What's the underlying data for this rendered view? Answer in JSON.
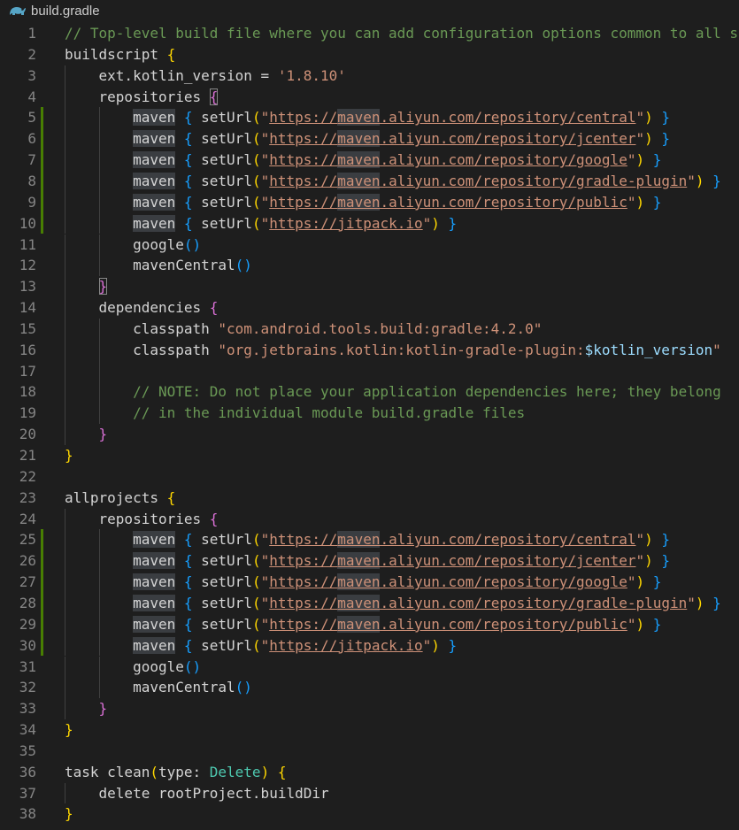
{
  "tab": {
    "title": "build.gradle",
    "icon": "gradle-elephant-icon",
    "icon_color": "#56a5c6"
  },
  "colors": {
    "background": "#1e1e1e",
    "line_number": "#858585",
    "added_line_marker": "#487e02",
    "comment": "#6a9955",
    "string": "#ce9178",
    "variable": "#9cdcfe",
    "type": "#4ec9b0",
    "bracket_level_1": "#ffd700",
    "bracket_level_2": "#da70d6",
    "bracket_level_3": "#179fff"
  },
  "lines": [
    {
      "num": "1",
      "modified": false,
      "guides": 0,
      "tokens": [
        {
          "t": "// Top-level build file where you can add configuration options common to all sub-projects/modules.",
          "c": "comment"
        }
      ]
    },
    {
      "num": "2",
      "modified": false,
      "guides": 0,
      "tokens": [
        {
          "t": "buildscript "
        },
        {
          "t": "{",
          "c": "b1"
        }
      ]
    },
    {
      "num": "3",
      "modified": false,
      "guides": 1,
      "tokens": [
        {
          "t": "    ext.kotlin_version = "
        },
        {
          "t": "'1.8.10'",
          "c": "str"
        }
      ]
    },
    {
      "num": "4",
      "modified": false,
      "guides": 1,
      "tokens": [
        {
          "t": "    repositories "
        },
        {
          "t": "{",
          "c": "b2",
          "m": "bm"
        }
      ]
    },
    {
      "num": "5",
      "modified": true,
      "guides": 2,
      "tokens": [
        {
          "t": "        "
        },
        {
          "t": "maven",
          "c": "hl"
        },
        {
          "t": " "
        },
        {
          "t": "{",
          "c": "b3"
        },
        {
          "t": " setUrl"
        },
        {
          "t": "(",
          "c": "b1"
        },
        {
          "t": "\"",
          "c": "str"
        },
        {
          "t": "https://",
          "c": "url"
        },
        {
          "t": "maven",
          "c": "url",
          "m": "hl"
        },
        {
          "t": ".aliyun.com/repository/central",
          "c": "url"
        },
        {
          "t": "\"",
          "c": "str"
        },
        {
          "t": ")",
          "c": "b1"
        },
        {
          "t": " "
        },
        {
          "t": "}",
          "c": "b3"
        }
      ]
    },
    {
      "num": "6",
      "modified": true,
      "guides": 2,
      "tokens": [
        {
          "t": "        "
        },
        {
          "t": "maven",
          "c": "hl"
        },
        {
          "t": " "
        },
        {
          "t": "{",
          "c": "b3"
        },
        {
          "t": " setUrl"
        },
        {
          "t": "(",
          "c": "b1"
        },
        {
          "t": "\"",
          "c": "str"
        },
        {
          "t": "https://",
          "c": "url"
        },
        {
          "t": "maven",
          "c": "url",
          "m": "hl"
        },
        {
          "t": ".aliyun.com/repository/jcenter",
          "c": "url"
        },
        {
          "t": "\"",
          "c": "str"
        },
        {
          "t": ")",
          "c": "b1"
        },
        {
          "t": " "
        },
        {
          "t": "}",
          "c": "b3"
        }
      ]
    },
    {
      "num": "7",
      "modified": true,
      "guides": 2,
      "tokens": [
        {
          "t": "        "
        },
        {
          "t": "maven",
          "c": "hl"
        },
        {
          "t": " "
        },
        {
          "t": "{",
          "c": "b3"
        },
        {
          "t": " setUrl"
        },
        {
          "t": "(",
          "c": "b1"
        },
        {
          "t": "\"",
          "c": "str"
        },
        {
          "t": "https://",
          "c": "url"
        },
        {
          "t": "maven",
          "c": "url",
          "m": "hl"
        },
        {
          "t": ".aliyun.com/repository/google",
          "c": "url"
        },
        {
          "t": "\"",
          "c": "str"
        },
        {
          "t": ")",
          "c": "b1"
        },
        {
          "t": " "
        },
        {
          "t": "}",
          "c": "b3"
        }
      ]
    },
    {
      "num": "8",
      "modified": true,
      "guides": 2,
      "tokens": [
        {
          "t": "        "
        },
        {
          "t": "maven",
          "c": "hl"
        },
        {
          "t": " "
        },
        {
          "t": "{",
          "c": "b3"
        },
        {
          "t": " setUrl"
        },
        {
          "t": "(",
          "c": "b1"
        },
        {
          "t": "\"",
          "c": "str"
        },
        {
          "t": "https://",
          "c": "url"
        },
        {
          "t": "maven",
          "c": "url",
          "m": "hl"
        },
        {
          "t": ".aliyun.com/repository/gradle-plugin",
          "c": "url"
        },
        {
          "t": "\"",
          "c": "str"
        },
        {
          "t": ")",
          "c": "b1"
        },
        {
          "t": " "
        },
        {
          "t": "}",
          "c": "b3"
        }
      ]
    },
    {
      "num": "9",
      "modified": true,
      "guides": 2,
      "tokens": [
        {
          "t": "        "
        },
        {
          "t": "maven",
          "c": "hl"
        },
        {
          "t": " "
        },
        {
          "t": "{",
          "c": "b3"
        },
        {
          "t": " setUrl"
        },
        {
          "t": "(",
          "c": "b1"
        },
        {
          "t": "\"",
          "c": "str"
        },
        {
          "t": "https://",
          "c": "url"
        },
        {
          "t": "maven",
          "c": "url",
          "m": "hl"
        },
        {
          "t": ".aliyun.com/repository/public",
          "c": "url"
        },
        {
          "t": "\"",
          "c": "str"
        },
        {
          "t": ")",
          "c": "b1"
        },
        {
          "t": " "
        },
        {
          "t": "}",
          "c": "b3"
        }
      ]
    },
    {
      "num": "10",
      "modified": true,
      "guides": 2,
      "tokens": [
        {
          "t": "        "
        },
        {
          "t": "maven",
          "c": "hl"
        },
        {
          "t": " "
        },
        {
          "t": "{",
          "c": "b3"
        },
        {
          "t": " setUrl"
        },
        {
          "t": "(",
          "c": "b1"
        },
        {
          "t": "\"",
          "c": "str"
        },
        {
          "t": "https://jitpack.io",
          "c": "url"
        },
        {
          "t": "\"",
          "c": "str"
        },
        {
          "t": ")",
          "c": "b1"
        },
        {
          "t": " "
        },
        {
          "t": "}",
          "c": "b3"
        }
      ]
    },
    {
      "num": "11",
      "modified": false,
      "guides": 2,
      "tokens": [
        {
          "t": "        google"
        },
        {
          "t": "()",
          "c": "b3"
        }
      ]
    },
    {
      "num": "12",
      "modified": false,
      "guides": 2,
      "tokens": [
        {
          "t": "        mavenCentral"
        },
        {
          "t": "()",
          "c": "b3"
        }
      ]
    },
    {
      "num": "13",
      "modified": false,
      "guides": 1,
      "tokens": [
        {
          "t": "    "
        },
        {
          "t": "}",
          "c": "b2",
          "m": "bm"
        }
      ]
    },
    {
      "num": "14",
      "modified": false,
      "guides": 1,
      "tokens": [
        {
          "t": "    dependencies "
        },
        {
          "t": "{",
          "c": "b2"
        }
      ]
    },
    {
      "num": "15",
      "modified": false,
      "guides": 2,
      "tokens": [
        {
          "t": "        classpath "
        },
        {
          "t": "\"com.android.tools.build:gradle:4.2.0\"",
          "c": "str"
        }
      ]
    },
    {
      "num": "16",
      "modified": false,
      "guides": 2,
      "tokens": [
        {
          "t": "        classpath "
        },
        {
          "t": "\"org.jetbrains.kotlin:kotlin-gradle-plugin:",
          "c": "str"
        },
        {
          "t": "$kotlin_version",
          "c": "var"
        },
        {
          "t": "\"",
          "c": "str"
        }
      ]
    },
    {
      "num": "17",
      "modified": false,
      "guides": 2,
      "tokens": []
    },
    {
      "num": "18",
      "modified": false,
      "guides": 2,
      "tokens": [
        {
          "t": "        "
        },
        {
          "t": "// NOTE: Do not place your application dependencies here; they belong",
          "c": "comment"
        }
      ]
    },
    {
      "num": "19",
      "modified": false,
      "guides": 2,
      "tokens": [
        {
          "t": "        "
        },
        {
          "t": "// in the individual module build.gradle files",
          "c": "comment"
        }
      ]
    },
    {
      "num": "20",
      "modified": false,
      "guides": 1,
      "tokens": [
        {
          "t": "    "
        },
        {
          "t": "}",
          "c": "b2"
        }
      ]
    },
    {
      "num": "21",
      "modified": false,
      "guides": 0,
      "tokens": [
        {
          "t": "}",
          "c": "b1"
        }
      ]
    },
    {
      "num": "22",
      "modified": false,
      "guides": 0,
      "tokens": []
    },
    {
      "num": "23",
      "modified": false,
      "guides": 0,
      "tokens": [
        {
          "t": "allprojects "
        },
        {
          "t": "{",
          "c": "b1"
        }
      ]
    },
    {
      "num": "24",
      "modified": false,
      "guides": 1,
      "tokens": [
        {
          "t": "    repositories "
        },
        {
          "t": "{",
          "c": "b2"
        }
      ]
    },
    {
      "num": "25",
      "modified": true,
      "guides": 2,
      "tokens": [
        {
          "t": "        "
        },
        {
          "t": "maven",
          "c": "hl"
        },
        {
          "t": " "
        },
        {
          "t": "{",
          "c": "b3"
        },
        {
          "t": " setUrl"
        },
        {
          "t": "(",
          "c": "b1"
        },
        {
          "t": "\"",
          "c": "str"
        },
        {
          "t": "https://",
          "c": "url"
        },
        {
          "t": "maven",
          "c": "url",
          "m": "hl"
        },
        {
          "t": ".aliyun.com/repository/central",
          "c": "url"
        },
        {
          "t": "\"",
          "c": "str"
        },
        {
          "t": ")",
          "c": "b1"
        },
        {
          "t": " "
        },
        {
          "t": "}",
          "c": "b3"
        }
      ]
    },
    {
      "num": "26",
      "modified": true,
      "guides": 2,
      "tokens": [
        {
          "t": "        "
        },
        {
          "t": "maven",
          "c": "hl"
        },
        {
          "t": " "
        },
        {
          "t": "{",
          "c": "b3"
        },
        {
          "t": " setUrl"
        },
        {
          "t": "(",
          "c": "b1"
        },
        {
          "t": "\"",
          "c": "str"
        },
        {
          "t": "https://",
          "c": "url"
        },
        {
          "t": "maven",
          "c": "url",
          "m": "hl"
        },
        {
          "t": ".aliyun.com/repository/jcenter",
          "c": "url"
        },
        {
          "t": "\"",
          "c": "str"
        },
        {
          "t": ")",
          "c": "b1"
        },
        {
          "t": " "
        },
        {
          "t": "}",
          "c": "b3"
        }
      ]
    },
    {
      "num": "27",
      "modified": true,
      "guides": 2,
      "tokens": [
        {
          "t": "        "
        },
        {
          "t": "maven",
          "c": "hl"
        },
        {
          "t": " "
        },
        {
          "t": "{",
          "c": "b3"
        },
        {
          "t": " setUrl"
        },
        {
          "t": "(",
          "c": "b1"
        },
        {
          "t": "\"",
          "c": "str"
        },
        {
          "t": "https://",
          "c": "url"
        },
        {
          "t": "maven",
          "c": "url",
          "m": "hl"
        },
        {
          "t": ".aliyun.com/repository/google",
          "c": "url"
        },
        {
          "t": "\"",
          "c": "str"
        },
        {
          "t": ")",
          "c": "b1"
        },
        {
          "t": " "
        },
        {
          "t": "}",
          "c": "b3"
        }
      ]
    },
    {
      "num": "28",
      "modified": true,
      "guides": 2,
      "tokens": [
        {
          "t": "        "
        },
        {
          "t": "maven",
          "c": "hl"
        },
        {
          "t": " "
        },
        {
          "t": "{",
          "c": "b3"
        },
        {
          "t": " setUrl"
        },
        {
          "t": "(",
          "c": "b1"
        },
        {
          "t": "\"",
          "c": "str"
        },
        {
          "t": "https://",
          "c": "url"
        },
        {
          "t": "maven",
          "c": "url",
          "m": "hl"
        },
        {
          "t": ".aliyun.com/repository/gradle-plugin",
          "c": "url"
        },
        {
          "t": "\"",
          "c": "str"
        },
        {
          "t": ")",
          "c": "b1"
        },
        {
          "t": " "
        },
        {
          "t": "}",
          "c": "b3"
        }
      ]
    },
    {
      "num": "29",
      "modified": true,
      "guides": 2,
      "tokens": [
        {
          "t": "        "
        },
        {
          "t": "maven",
          "c": "hl"
        },
        {
          "t": " "
        },
        {
          "t": "{",
          "c": "b3"
        },
        {
          "t": " setUrl"
        },
        {
          "t": "(",
          "c": "b1"
        },
        {
          "t": "\"",
          "c": "str"
        },
        {
          "t": "https://",
          "c": "url"
        },
        {
          "t": "maven",
          "c": "url",
          "m": "hl"
        },
        {
          "t": ".aliyun.com/repository/public",
          "c": "url"
        },
        {
          "t": "\"",
          "c": "str"
        },
        {
          "t": ")",
          "c": "b1"
        },
        {
          "t": " "
        },
        {
          "t": "}",
          "c": "b3"
        }
      ]
    },
    {
      "num": "30",
      "modified": true,
      "guides": 2,
      "tokens": [
        {
          "t": "        "
        },
        {
          "t": "maven",
          "c": "hl"
        },
        {
          "t": " "
        },
        {
          "t": "{",
          "c": "b3"
        },
        {
          "t": " setUrl"
        },
        {
          "t": "(",
          "c": "b1"
        },
        {
          "t": "\"",
          "c": "str"
        },
        {
          "t": "https://jitpack.io",
          "c": "url"
        },
        {
          "t": "\"",
          "c": "str"
        },
        {
          "t": ")",
          "c": "b1"
        },
        {
          "t": " "
        },
        {
          "t": "}",
          "c": "b3"
        }
      ]
    },
    {
      "num": "31",
      "modified": false,
      "guides": 2,
      "tokens": [
        {
          "t": "        google"
        },
        {
          "t": "()",
          "c": "b3"
        }
      ]
    },
    {
      "num": "32",
      "modified": false,
      "guides": 2,
      "tokens": [
        {
          "t": "        mavenCentral"
        },
        {
          "t": "()",
          "c": "b3"
        }
      ]
    },
    {
      "num": "33",
      "modified": false,
      "guides": 1,
      "tokens": [
        {
          "t": "    "
        },
        {
          "t": "}",
          "c": "b2"
        }
      ]
    },
    {
      "num": "34",
      "modified": false,
      "guides": 0,
      "tokens": [
        {
          "t": "}",
          "c": "b1"
        }
      ]
    },
    {
      "num": "35",
      "modified": false,
      "guides": 0,
      "tokens": []
    },
    {
      "num": "36",
      "modified": false,
      "guides": 0,
      "tokens": [
        {
          "t": "task clean"
        },
        {
          "t": "(",
          "c": "b1"
        },
        {
          "t": "type: "
        },
        {
          "t": "Delete",
          "c": "type"
        },
        {
          "t": ")",
          "c": "b1"
        },
        {
          "t": " "
        },
        {
          "t": "{",
          "c": "b1"
        }
      ]
    },
    {
      "num": "37",
      "modified": false,
      "guides": 1,
      "tokens": [
        {
          "t": "    delete rootProject.buildDir"
        }
      ]
    },
    {
      "num": "38",
      "modified": false,
      "guides": 0,
      "tokens": [
        {
          "t": "}",
          "c": "b1"
        }
      ]
    }
  ]
}
